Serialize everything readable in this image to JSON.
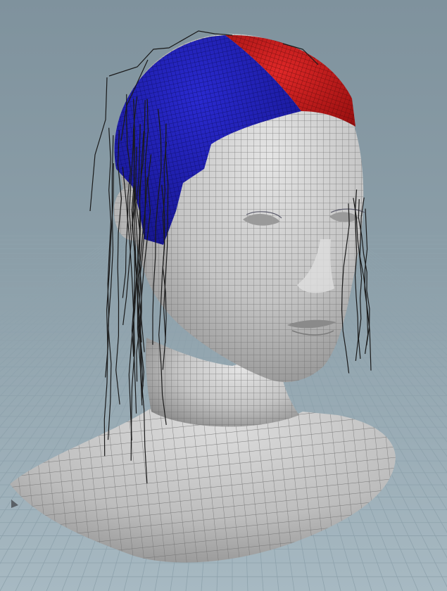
{
  "viewport": {
    "background_top": "#7f929d",
    "background_bottom": "#a3b6bf",
    "grid_line_color": "#8ea2ac",
    "mesh_fill": "#c8c8c8",
    "mesh_shade": "#8f8f8f",
    "wire_color": "#6a6a6a",
    "hair_region_blue": "#1f1fb0",
    "hair_region_red": "#c81e1e",
    "guide_curve_color": "#1a1a1a",
    "icons": [
      "view-orientation-icon"
    ]
  }
}
